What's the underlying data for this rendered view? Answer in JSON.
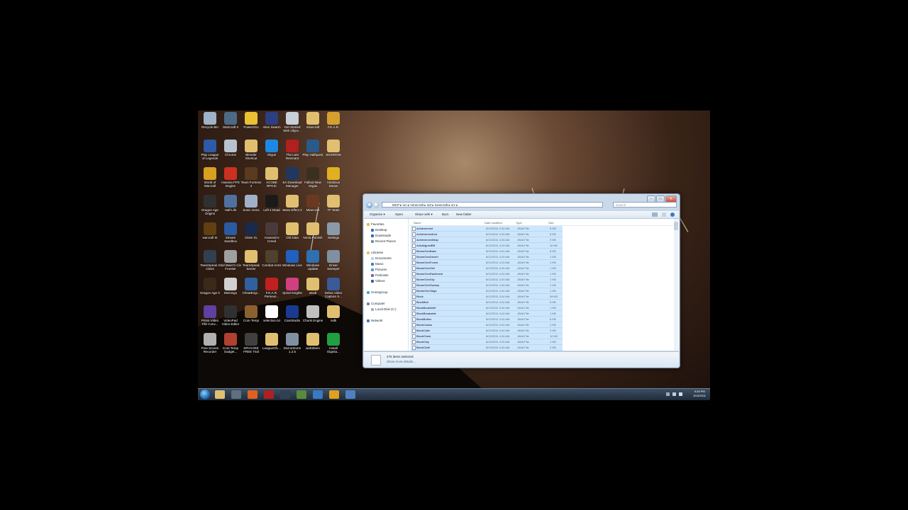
{
  "desktop": {
    "icons": [
      {
        "label": "Recycle Bin",
        "icon": "recycle-bin-icon",
        "color": "#9fb3c8"
      },
      {
        "label": "Startcraft II",
        "icon": "starcraft-icon",
        "color": "#4c6a86"
      },
      {
        "label": "Power2Go",
        "icon": "disc-icon",
        "color": "#e8c233"
      },
      {
        "label": "Alien Swarm",
        "icon": "alien-swarm-icon",
        "color": "#2c3f80"
      },
      {
        "label": "Get Started With Objec...",
        "icon": "shortcut-icon",
        "color": "#c7cfd8"
      },
      {
        "label": "minecraft",
        "icon": "folder-icon",
        "color": "#e0c070"
      },
      {
        "label": "F.E.A.R.",
        "icon": "fear-icon",
        "color": "#d6a030"
      },
      {
        "label": "Play League of Legends",
        "icon": "league-icon",
        "color": "#2e5aa8"
      },
      {
        "label": "Chrome",
        "icon": "browser-icon",
        "color": "#b7c3cf"
      },
      {
        "label": "Blender Shortcut",
        "icon": "folder-icon",
        "color": "#e0c070"
      },
      {
        "label": "Skype",
        "icon": "skype-icon",
        "color": "#1e88e5"
      },
      {
        "label": "The Last Remnant",
        "icon": "game-icon",
        "color": "#b02020"
      },
      {
        "label": "Play Halfquest",
        "icon": "game-icon",
        "color": "#2a5a8a"
      },
      {
        "label": "SKIDROW",
        "icon": "folder-icon",
        "color": "#e0c070"
      },
      {
        "label": "World of Warcraft",
        "icon": "wow-icon",
        "color": "#d8a020"
      },
      {
        "label": "Havana FPS Engine",
        "icon": "game-icon",
        "color": "#cc3020"
      },
      {
        "label": "Team Fortress 2",
        "icon": "tf2-icon",
        "color": "#5a3a20"
      },
      {
        "label": "ACOBE RPGIC",
        "icon": "folder-icon",
        "color": "#e0c070"
      },
      {
        "label": "EA Download Manager",
        "icon": "ea-icon",
        "color": "#203860"
      },
      {
        "label": "Fallout New Vegas",
        "icon": "game-icon",
        "color": "#3a3020"
      },
      {
        "label": "Vindictus Steam",
        "icon": "nuclear-icon",
        "color": "#e0b020"
      },
      {
        "label": "Dragon Age Origins",
        "icon": "game-icon",
        "color": "#303030"
      },
      {
        "label": "Half-Life",
        "icon": "game-icon",
        "color": "#5070a0"
      },
      {
        "label": "Sonic Gens",
        "icon": "game-icon",
        "color": "#a0b0c8"
      },
      {
        "label": "Left 4 Dead",
        "icon": "game-icon",
        "color": "#1a1a1a"
      },
      {
        "label": "Mass Effect 2",
        "icon": "folder-icon",
        "color": "#e0c070"
      },
      {
        "label": "Minecraft",
        "icon": "game-icon",
        "color": "#6a3a20"
      },
      {
        "label": "TF Stats",
        "icon": "folder-icon",
        "color": "#e0c070"
      },
      {
        "label": "warcraft III",
        "icon": "game-icon",
        "color": "#604010"
      },
      {
        "label": "Stream Sandbox",
        "icon": "steam-icon",
        "color": "#2a5aa0"
      },
      {
        "label": "Cities XL",
        "icon": "game-icon",
        "color": "#1a2a4a"
      },
      {
        "label": "Assassin's Creed",
        "icon": "game-icon",
        "color": "#4a3a3a"
      },
      {
        "label": "Old Data",
        "icon": "folder-icon",
        "color": "#e0c070"
      },
      {
        "label": "NoVa Publish",
        "icon": "folder-icon",
        "color": "#e0c070"
      },
      {
        "label": "Settings",
        "icon": "gear-icon",
        "color": "#8a9aaa"
      },
      {
        "label": "TeamSpeak 3 Client",
        "icon": "teamspeak-icon",
        "color": "#304050"
      },
      {
        "label": "Sid Meier's Civ Frontier",
        "icon": "game-icon",
        "color": "#a0a0a0"
      },
      {
        "label": "TeamSpeak Server",
        "icon": "folder-icon",
        "color": "#e0c070"
      },
      {
        "label": "Combat Arms",
        "icon": "game-icon",
        "color": "#504030"
      },
      {
        "label": "Windows Live",
        "icon": "windows-icon",
        "color": "#2060c0"
      },
      {
        "label": "Windows Update",
        "icon": "windows-icon",
        "color": "#3070b0"
      },
      {
        "label": "Driver Sweeper",
        "icon": "tool-icon",
        "color": "#8090a0"
      },
      {
        "label": "Dragon Age II",
        "icon": "game-icon",
        "color": "#3a2a1a"
      },
      {
        "label": "Meiningo",
        "icon": "game-icon",
        "color": "#d0d0d0"
      },
      {
        "label": "CheatEngi...",
        "icon": "tool-icon",
        "color": "#3060a0"
      },
      {
        "label": "F.E.A.R. Perseus...",
        "icon": "game-icon",
        "color": "#c02020"
      },
      {
        "label": "Spiral Knights",
        "icon": "game-icon",
        "color": "#d04080"
      },
      {
        "label": "wtsdt",
        "icon": "folder-icon",
        "color": "#e0c070"
      },
      {
        "label": "Debut Video Capture S...",
        "icon": "video-icon",
        "color": "#3a5a9a"
      },
      {
        "label": "Prism Video File Conv...",
        "icon": "video-icon",
        "color": "#6040a0"
      },
      {
        "label": "VideoPad Video Editor",
        "icon": "video-icon",
        "color": "#303030"
      },
      {
        "label": "Core Temp",
        "icon": "tool-icon",
        "color": "#8a6030"
      },
      {
        "label": "selection.txt",
        "icon": "text-file-icon",
        "color": "#ffffff"
      },
      {
        "label": "CamStudio",
        "icon": "video-icon",
        "color": "#1a3a90"
      },
      {
        "label": "Chunk Engine",
        "icon": "tool-icon",
        "color": "#c0c0c0"
      },
      {
        "label": "rsdk",
        "icon": "folder-icon",
        "color": "#e0c070"
      },
      {
        "label": "Free Screen Recorder",
        "icon": "video-icon",
        "color": "#b0b0b0"
      },
      {
        "label": "Core Temp Gadget...",
        "icon": "tool-icon",
        "color": "#b04030"
      },
      {
        "label": "SPHYARE FREE Trial",
        "icon": "tool-icon",
        "color": "#404040"
      },
      {
        "label": "LeagueOfL...",
        "icon": "folder-icon",
        "color": "#e0c070"
      },
      {
        "label": "DivineStorm 1.2.5",
        "icon": "tool-icon",
        "color": "#8090a0"
      },
      {
        "label": "webSkem",
        "icon": "folder-icon",
        "color": "#e0c070"
      },
      {
        "label": "Install Dignita...",
        "icon": "tool-icon",
        "color": "#20a040"
      }
    ]
  },
  "taskbar": {
    "items": [
      {
        "icon": "folder-icon",
        "color": "#e0c070"
      },
      {
        "icon": "steam-icon",
        "color": "#607080"
      },
      {
        "icon": "firefox-icon",
        "color": "#e06020"
      },
      {
        "icon": "game-icon",
        "color": "#b02020"
      },
      {
        "icon": "teamspeak-icon",
        "color": "#304050"
      },
      {
        "icon": "minecraft-icon",
        "color": "#5a8a3a"
      },
      {
        "icon": "shield-icon",
        "color": "#3a7ac0"
      },
      {
        "icon": "folder-icon",
        "color": "#e0a020"
      },
      {
        "icon": "disk-icon",
        "color": "#5080c0"
      }
    ],
    "clock_time": "5:28 PM",
    "clock_date": "8/13/2011"
  },
  "explorer": {
    "nav": {
      "back": "◀",
      "forward": "▶"
    },
    "breadcrumb": "MCP  ▸  src  ▸  minecraft  ▸  net  ▸  minecraft  ▸  src  ▸",
    "search_placeholder": "Search",
    "toolbar": {
      "organize": "Organize ▾",
      "open": "Open",
      "share": "Share with ▾",
      "burn": "Burn",
      "new_folder": "New folder"
    },
    "sidebar": {
      "favorites": "Favorites",
      "desktop": "Desktop",
      "downloads": "Downloads",
      "recent": "Recent Places",
      "libraries": "Libraries",
      "documents": "Documents",
      "music": "Music",
      "pictures": "Pictures",
      "podcasts": "Podcasts",
      "videos": "Videos",
      "homegroup": "Homegroup",
      "computer": "Computer",
      "local_disk": "Local Disk (C:)",
      "network": "Network"
    },
    "columns": {
      "name": "Name",
      "date": "Date modified",
      "type": "Type",
      "size": "Size"
    },
    "files": [
      {
        "name": "Achievement",
        "date": "8/12/2011 4:24 AM",
        "type": "JAVA File",
        "size": "6 KB"
      },
      {
        "name": "AchievementList",
        "date": "8/12/2011 4:24 AM",
        "type": "JAVA File",
        "size": "8 KB"
      },
      {
        "name": "AchievementMap",
        "date": "8/12/2011 4:24 AM",
        "type": "JAVA File",
        "size": "2 KB"
      },
      {
        "name": "AxisAlignedBB",
        "date": "8/12/2011 4:24 AM",
        "type": "JAVA File",
        "size": "10 KB"
      },
      {
        "name": "BiomeGenBase",
        "date": "8/12/2011 4:24 AM",
        "type": "JAVA File",
        "size": "6 KB"
      },
      {
        "name": "BiomeGenDesert",
        "date": "8/12/2011 4:24 AM",
        "type": "JAVA File",
        "size": "1 KB"
      },
      {
        "name": "BiomeGenForest",
        "date": "8/12/2011 4:24 AM",
        "type": "JAVA File",
        "size": "1 KB"
      },
      {
        "name": "BiomeGenHell",
        "date": "8/12/2011 4:24 AM",
        "type": "JAVA File",
        "size": "1 KB"
      },
      {
        "name": "BiomeGenRainforest",
        "date": "8/12/2011 4:24 AM",
        "type": "JAVA File",
        "size": "1 KB"
      },
      {
        "name": "BiomeGenSky",
        "date": "8/12/2011 4:24 AM",
        "type": "JAVA File",
        "size": "1 KB"
      },
      {
        "name": "BiomeGenSwamp",
        "date": "8/12/2011 4:24 AM",
        "type": "JAVA File",
        "size": "1 KB"
      },
      {
        "name": "BiomeGenTaiga",
        "date": "8/12/2011 4:24 AM",
        "type": "JAVA File",
        "size": "1 KB"
      },
      {
        "name": "Block",
        "date": "8/12/2011 4:24 AM",
        "type": "JAVA File",
        "size": "28 KB"
      },
      {
        "name": "BlockBed",
        "date": "8/12/2011 4:24 AM",
        "type": "JAVA File",
        "size": "6 KB"
      },
      {
        "name": "BlockBookshelf",
        "date": "8/12/2011 4:24 AM",
        "type": "JAVA File",
        "size": "1 KB"
      },
      {
        "name": "BlockBreakable",
        "date": "8/12/2011 4:24 AM",
        "type": "JAVA File",
        "size": "1 KB"
      },
      {
        "name": "BlockButton",
        "date": "8/12/2011 4:24 AM",
        "type": "JAVA File",
        "size": "6 KB"
      },
      {
        "name": "BlockCactus",
        "date": "8/12/2011 4:24 AM",
        "type": "JAVA File",
        "size": "2 KB"
      },
      {
        "name": "BlockCake",
        "date": "8/12/2011 4:24 AM",
        "type": "JAVA File",
        "size": "3 KB"
      },
      {
        "name": "BlockChest",
        "date": "8/12/2011 4:24 AM",
        "type": "JAVA File",
        "size": "10 KB"
      },
      {
        "name": "BlockClay",
        "date": "8/12/2011 4:24 AM",
        "type": "JAVA File",
        "size": "1 KB"
      },
      {
        "name": "BlockCloth",
        "date": "8/12/2011 4:24 AM",
        "type": "JAVA File",
        "size": "2 KB"
      }
    ],
    "status_count": "476 items selected",
    "status_more": "Show more details..."
  }
}
